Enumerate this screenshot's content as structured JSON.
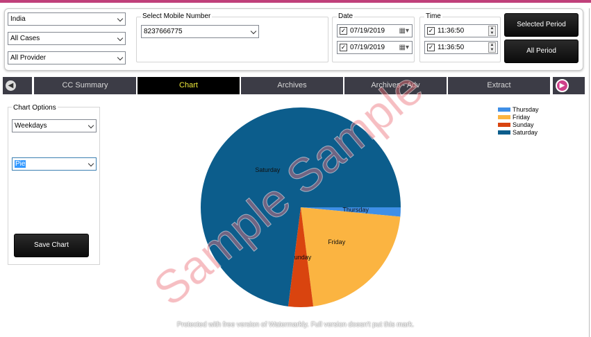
{
  "filters": {
    "country": "India",
    "cases": "All Cases",
    "provider": "All Provider",
    "mobile_group_title": "Select Mobile Number",
    "mobile_number": "8237666775",
    "date_group_title": "Date",
    "date_from": "07/19/2019",
    "date_to": "07/19/2019",
    "time_group_title": "Time",
    "time_from": "11:36:50",
    "time_to": "11:36:50",
    "selected_period_label": "Selected Period",
    "all_period_label": "All Period"
  },
  "tabs": [
    "CC Summary",
    "Chart",
    "Archives",
    "Archives - Adv",
    "Extract"
  ],
  "active_tab": "Chart",
  "chart_options": {
    "title": "Chart Options",
    "grouping": "Weekdays",
    "chart_type": "Pie",
    "save_label": "Save Chart"
  },
  "chart_data": {
    "type": "pie",
    "categories": [
      "Thursday",
      "Friday",
      "Sunday",
      "Saturday"
    ],
    "values": [
      1.5,
      21.5,
      4.0,
      73.0
    ],
    "colors": [
      "#3f8fe6",
      "#fbb441",
      "#d9440f",
      "#0c5d8c"
    ],
    "legend": "top-right"
  },
  "watermark": {
    "diagonal": "Sample Sample",
    "footer": "Protected with free version of Watermarkly. Full version doesn't put this mark."
  },
  "colors": {
    "active_tab_text": "#f0ea3a",
    "tab_bg": "#3c3c46",
    "accent": "#c0407a"
  }
}
